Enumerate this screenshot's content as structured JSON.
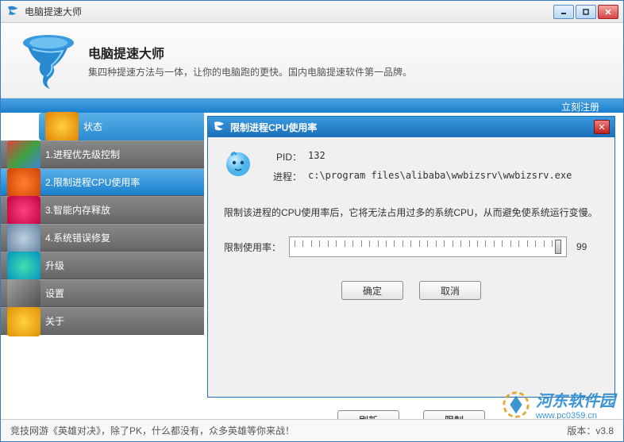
{
  "window": {
    "title": "电脑提速大师"
  },
  "header": {
    "title": "电脑提速大师",
    "subtitle": "集四种提速方法与一体，让你的电脑跑的更快。国内电脑提速软件第一品牌。"
  },
  "banner": {
    "register": "立刻注册"
  },
  "sidebar": {
    "items": [
      {
        "label": "状态"
      },
      {
        "label": "1.进程优先级控制"
      },
      {
        "label": "2.限制进程CPU使用率"
      },
      {
        "label": "3.智能内存释放"
      },
      {
        "label": "4.系统错误修复"
      },
      {
        "label": "升级"
      },
      {
        "label": "设置"
      },
      {
        "label": "关于"
      }
    ]
  },
  "dialog": {
    "title": "限制进程CPU使用率",
    "pid_label": "PID：",
    "pid_value": "132",
    "proc_label": "进程：",
    "proc_value": "c:\\program files\\alibaba\\wwbizsrv\\wwbizsrv.exe",
    "description": "限制该进程的CPU使用率后，它将无法占用过多的系统CPU，从而避免使系统运行变慢。",
    "slider_label": "限制使用率：",
    "slider_value": "99",
    "ok": "确定",
    "cancel": "取消"
  },
  "content_buttons": {
    "refresh": "刷新",
    "limit": "限制"
  },
  "footer": {
    "text": "竞技网游《英雄对决》，除了PK，什么都没有，众多英雄等你来战！",
    "version": "版本：v3.8"
  },
  "watermark": {
    "name": "河东软件园",
    "url": "www.pc0359.cn"
  }
}
